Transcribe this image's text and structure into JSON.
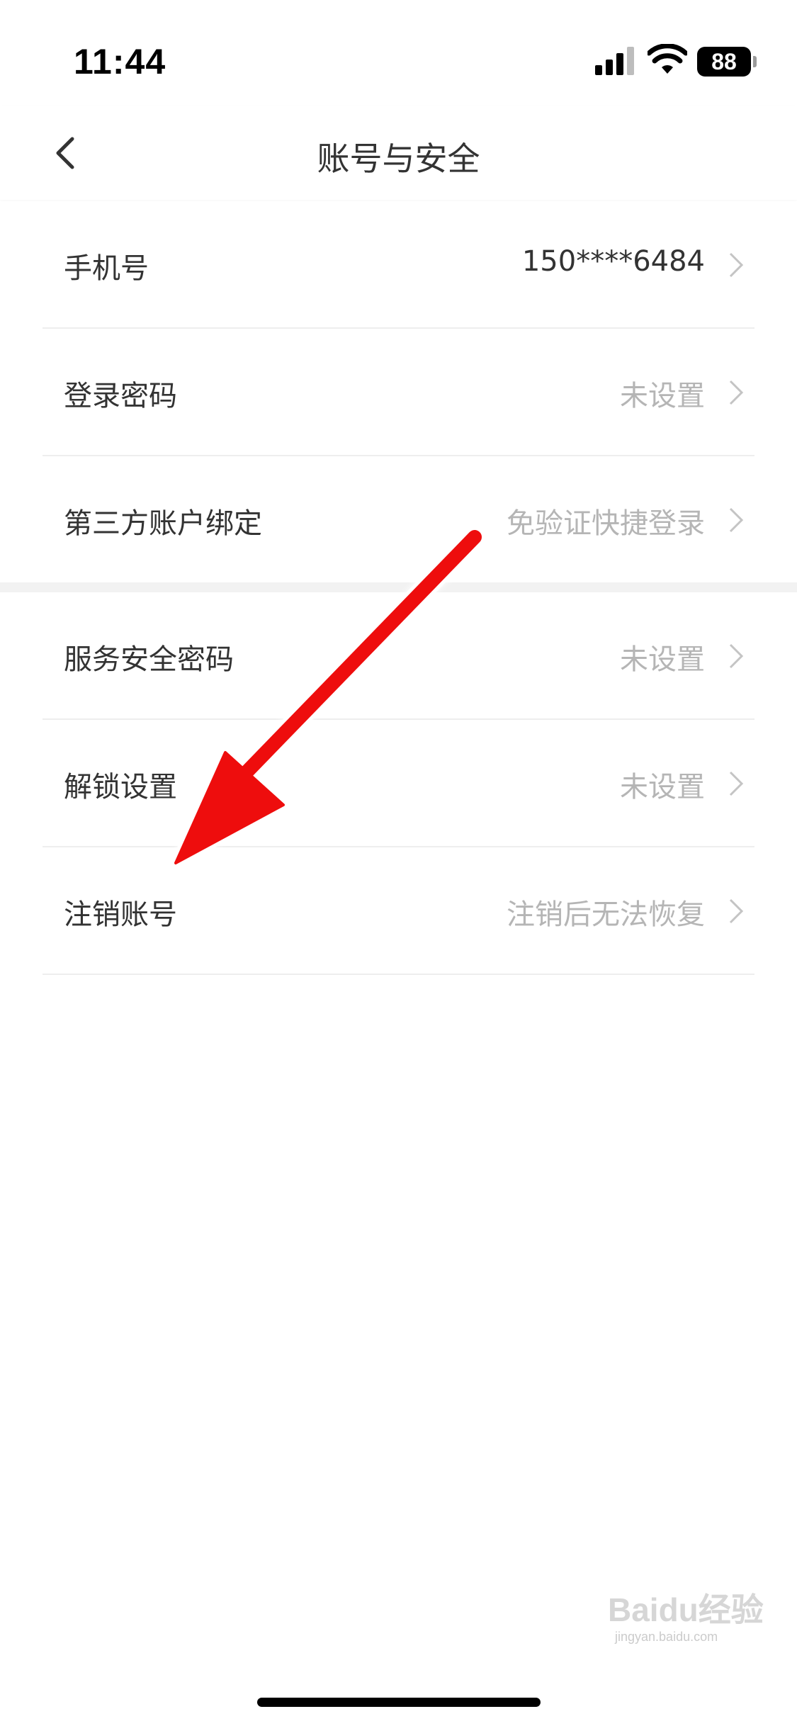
{
  "status_bar": {
    "time": "11:44",
    "battery": "88"
  },
  "nav": {
    "title": "账号与安全",
    "back_icon": "chevron-left-icon"
  },
  "groups": [
    {
      "rows": [
        {
          "label": "手机号",
          "value": "150****6484"
        },
        {
          "label": "登录密码",
          "value": "未设置"
        },
        {
          "label": "第三方账户绑定",
          "value": "免验证快捷登录"
        }
      ]
    },
    {
      "rows": [
        {
          "label": "服务安全密码",
          "value": "未设置"
        },
        {
          "label": "解锁设置",
          "value": "未设置"
        },
        {
          "label": "注销账号",
          "value": "注销后无法恢复"
        }
      ]
    }
  ],
  "annotation": {
    "color": "#ee1111",
    "target": "注销账号"
  },
  "watermark": {
    "brand": "Baidu经验",
    "url": "jingyan.baidu.com"
  },
  "colors": {
    "text_primary": "#333333",
    "text_secondary": "#b5b5b5",
    "divider": "#eeeeee",
    "group_gap": "#f2f2f2"
  }
}
